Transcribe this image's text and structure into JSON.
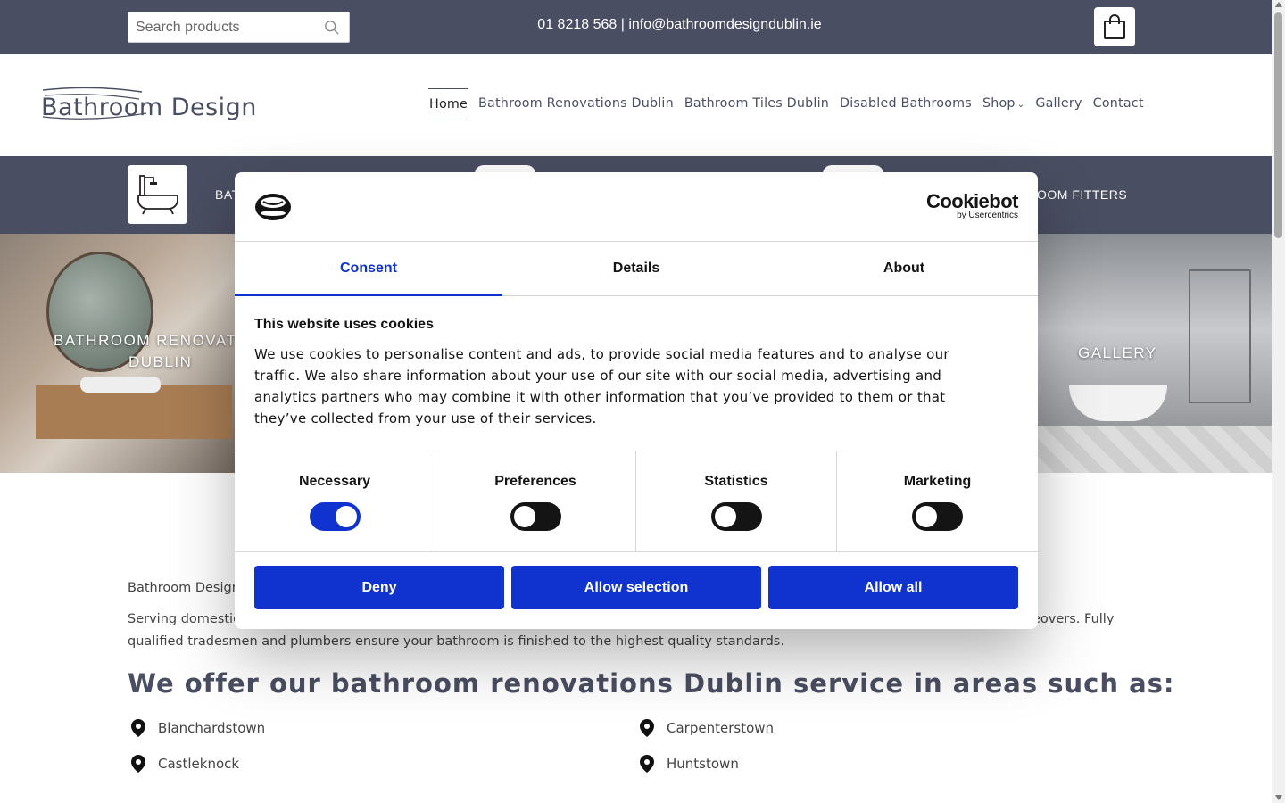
{
  "topbar": {
    "search_placeholder": "Search products",
    "contact": "01 8218 568 | info@bathroomdesigndublin.ie"
  },
  "header": {
    "logo_text": "Bathroom Design",
    "nav": [
      {
        "label": "Home",
        "active": true
      },
      {
        "label": "Bathroom Renovations Dublin"
      },
      {
        "label": "Bathroom Tiles Dublin"
      },
      {
        "label": "Disabled Bathrooms"
      },
      {
        "label": "Shop"
      },
      {
        "label": "Gallery"
      },
      {
        "label": "Contact"
      }
    ]
  },
  "strip": {
    "text_left": "BAT",
    "text_right": "OOM FITTERS"
  },
  "hero": {
    "left_caption_line1": "BATHROOM RENOVATIO",
    "left_caption_line2": "DUBLIN",
    "right_caption": "GALLERY"
  },
  "content": {
    "p1": "Bathroom Design",
    "p2_line1": "Serving domestic",
    "p2_tail": "eovers. Fully",
    "p2_line2": "qualified tradesmen and plumbers ensure your bathroom is finished to the highest quality standards.",
    "heading": "We offer our bathroom renovations Dublin service in areas such as:",
    "areas": [
      "Blanchardstown",
      "Carpenterstown",
      "Castleknock",
      "Huntstown"
    ]
  },
  "cookie_dialog": {
    "brand_main": "Cookiebot",
    "brand_sub": "by Usercentrics",
    "tabs": [
      "Consent",
      "Details",
      "About"
    ],
    "active_tab": "Consent",
    "title": "This website uses cookies",
    "text": "We use cookies to personalise content and ads, to provide social media features and to analyse our traffic. We also share information about your use of our site with our social media, advertising and analytics partners who may combine it with other information that you’ve provided to them or that they’ve collected from your use of their services.",
    "toggles": [
      {
        "label": "Necessary",
        "on": true
      },
      {
        "label": "Preferences",
        "on": false
      },
      {
        "label": "Statistics",
        "on": false
      },
      {
        "label": "Marketing",
        "on": false
      }
    ],
    "buttons": [
      "Deny",
      "Allow selection",
      "Allow all"
    ],
    "accent_color": "#1032cf"
  },
  "colors": {
    "brand_dark": "#4a4e62",
    "accent": "#1032cf"
  },
  "icons": {
    "search": "search-icon",
    "cart": "shopping-bag-icon",
    "bath": "bathtub-icon",
    "pin": "map-pin-icon",
    "cookie_logo": "cookie-logo-icon"
  }
}
